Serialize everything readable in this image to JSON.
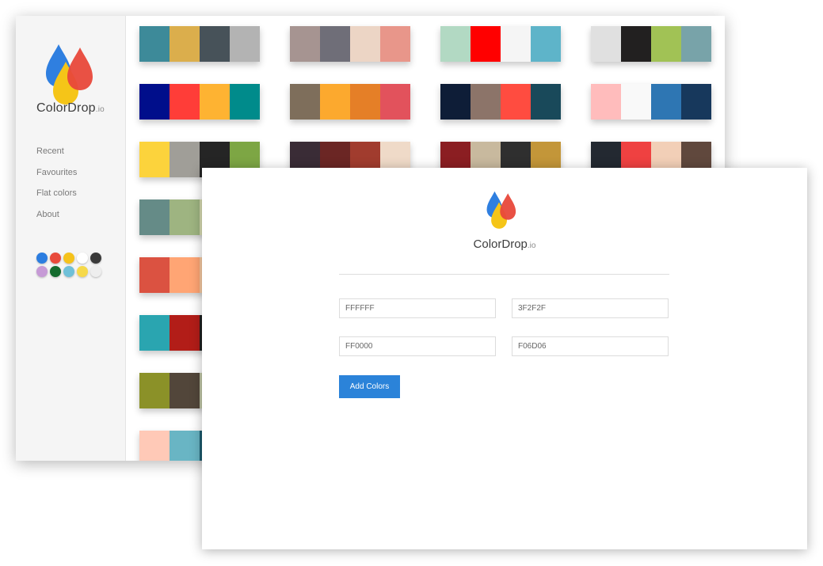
{
  "brand": {
    "name": "ColorDrop",
    "suffix": ".io"
  },
  "logo_colors": {
    "blue": "#2f7fe0",
    "yellow": "#f5c518",
    "red": "#e8483a"
  },
  "sidebar": {
    "nav": [
      {
        "label": "Recent"
      },
      {
        "label": "Favourites"
      },
      {
        "label": "Flat colors"
      },
      {
        "label": "About"
      }
    ],
    "color_dots": [
      [
        "#2b7de0",
        "#e84a3b",
        "#f5c21b",
        "#ffffff",
        "#3a3a3a"
      ],
      [
        "#c69ad6",
        "#146b2e",
        "#6fc0d8",
        "#f6d94a",
        "#eeeeee"
      ]
    ]
  },
  "palettes": [
    [
      "#3d8a99",
      "#dbae4c",
      "#475259",
      "#b3b3b3"
    ],
    [
      "#a69491",
      "#6f6e78",
      "#ecd5c5",
      "#e8968a"
    ],
    [
      "#b2d9c3",
      "#ff0000",
      "#f5f5f5",
      "#5eb4c9"
    ],
    [
      "#e0e0e0",
      "#222020",
      "#a1c255",
      "#78a3a9"
    ],
    [
      "#000e8b",
      "#ff3d38",
      "#feb332",
      "#008b8b"
    ],
    [
      "#7e6e5b",
      "#fca92e",
      "#e57f27",
      "#e2525c"
    ],
    [
      "#0e1d37",
      "#8c7469",
      "#ff4c40",
      "#19495a"
    ],
    [
      "#ffbcbc",
      "#f9f9f9",
      "#2e76b3",
      "#17385c"
    ],
    [
      "#fcd33c",
      "#a09e98",
      "#252525",
      "#7da644"
    ],
    [
      "#3a2c36",
      "#6b2624",
      "#a13c2e",
      "#efdac8"
    ],
    [
      "#8b1e22",
      "#c8b99e",
      "#2f2f2f",
      "#c39639"
    ],
    [
      "#232931",
      "#ef4141",
      "#f2cfb7",
      "#60483d"
    ],
    [
      "#658b87",
      "#9eb481",
      "#d6dbb0",
      "#ececd4"
    ],
    [
      "#db5241",
      "#ffa574",
      "#f7c9a0",
      "#fff0d6"
    ],
    [
      "#2aa5b0",
      "#b21d18",
      "#1f1f1f",
      "#f4e7c0"
    ],
    [
      "#8b9128",
      "#52463a",
      "#c0c6a6",
      "#e6e4d6"
    ],
    [
      "#ffc9b7",
      "#69b5c4",
      "#1c5b6e",
      "#eeeeee"
    ]
  ],
  "form": {
    "inputs": [
      {
        "value": "FFFFFF"
      },
      {
        "value": "3F2F2F"
      },
      {
        "value": "FF0000"
      },
      {
        "value": "F06D06"
      }
    ],
    "add_button_label": "Add Colors",
    "accent": "#2b83d9"
  }
}
